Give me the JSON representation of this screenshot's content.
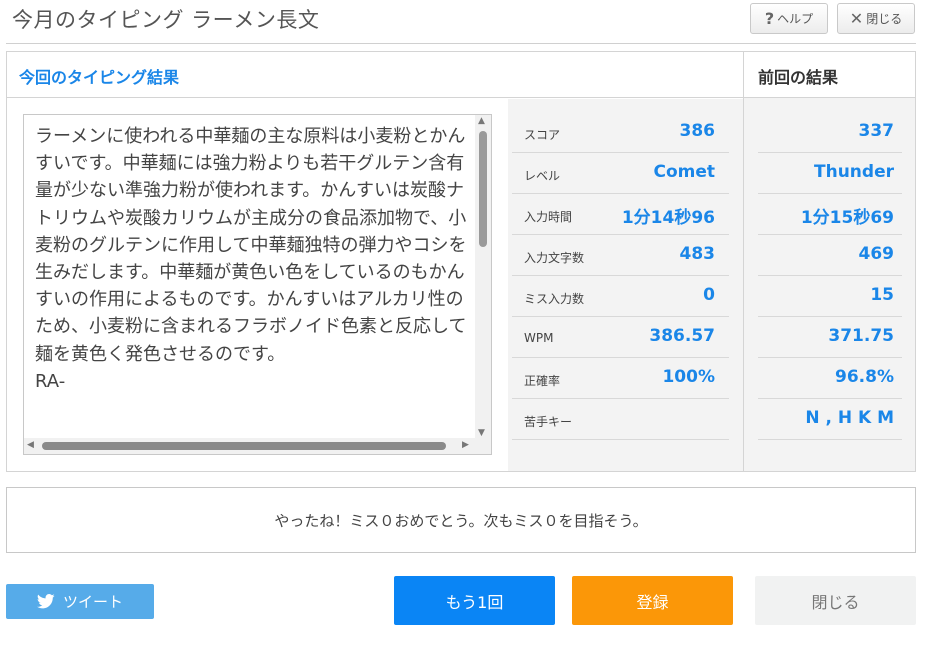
{
  "header": {
    "title": "今月のタイピング ラーメン長文",
    "help_label": "ヘルプ",
    "close_label": "閉じる"
  },
  "results": {
    "current_heading": "今回のタイピング結果",
    "previous_heading": "前回の結果",
    "typed_text": "ラーメンに使われる中華麺の主な原料は小麦粉とかんすいです。中華麺には強力粉よりも若干グルテン含有量が少ない準強力粉が使われます。かんすいは炭酸ナトリウムや炭酸カリウムが主成分の食品添加物で、小麦粉のグルテンに作用して中華麺独特の弾力やコシを生みだします。中華麺が黄色い色をしているのもかんすいの作用によるものです。かんすいはアルカリ性のため、小麦粉に含まれるフラボノイド色素と反応して麺を黄色く発色させるのです。\nRA-",
    "stats": [
      {
        "label": "スコア",
        "current": "386",
        "previous": "337"
      },
      {
        "label": "レベル",
        "current": "Comet",
        "previous": "Thunder"
      },
      {
        "label": "入力時間",
        "current": "1分14秒96",
        "previous": "1分15秒69"
      },
      {
        "label": "入力文字数",
        "current": "483",
        "previous": "469"
      },
      {
        "label": "ミス入力数",
        "current": "0",
        "previous": "15"
      },
      {
        "label": "WPM",
        "current": "386.57",
        "previous": "371.75"
      },
      {
        "label": "正確率",
        "current": "100%",
        "previous": "96.8%"
      },
      {
        "label": "苦手キー",
        "current": "",
        "previous": "N , H K M"
      }
    ]
  },
  "message": "やったね！ミス０おめでとう。次もミス０を目指そう。",
  "buttons": {
    "tweet": "ツイート",
    "retry": "もう1回",
    "register": "登録",
    "close": "閉じる"
  },
  "colors": {
    "accent_blue": "#1a86e8",
    "retry_bg": "#0a85f5",
    "register_bg": "#fb9708",
    "tweet_bg": "#56abe9"
  }
}
